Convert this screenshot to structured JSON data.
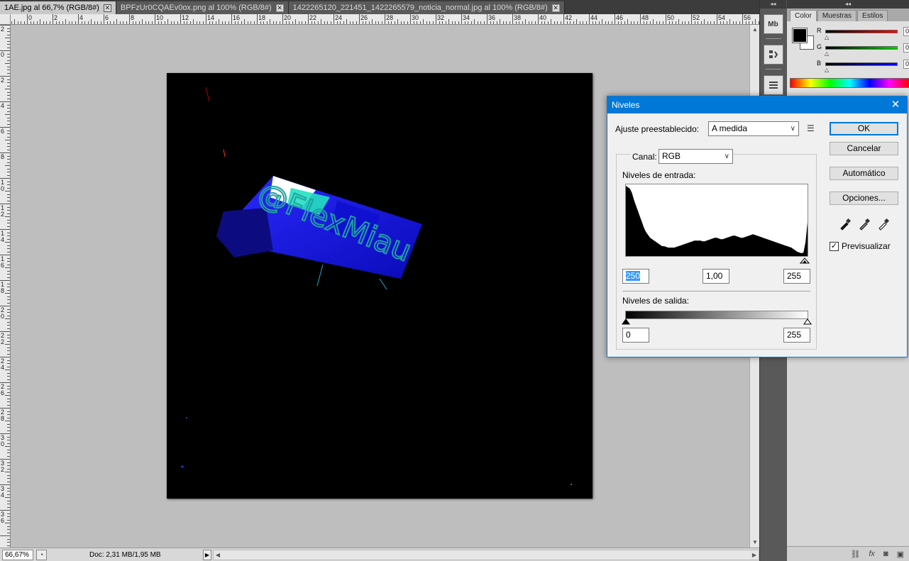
{
  "tabs": [
    {
      "label": "1AE.jpg al 66,7% (RGB/8#)",
      "active": true
    },
    {
      "label": "BPFzUr0CQAEv0ox.png al 100% (RGB/8#)",
      "active": false
    },
    {
      "label": "1422265120_221451_1422265579_noticia_normal.jpg al 100% (RGB/8#)",
      "active": false
    }
  ],
  "tab_close_glyph": "✕",
  "ruler_top_numbers": [
    "2",
    "0",
    "2",
    "4",
    "6",
    "8",
    "10",
    "12",
    "14",
    "16",
    "18",
    "20",
    "22",
    "24",
    "26",
    "28",
    "30",
    "32",
    "34",
    "36",
    "38",
    "40",
    "42",
    "44",
    "46",
    "48",
    "50",
    "52",
    "54",
    "56"
  ],
  "ruler_left_numbers": [
    "2",
    "0",
    "2",
    "4",
    "6",
    "8",
    "10",
    "12",
    "14",
    "16",
    "18",
    "20",
    "22",
    "24",
    "26",
    "28",
    "30",
    "32",
    "34",
    "36"
  ],
  "document_image": {
    "description_icon": "image-canvas",
    "text_overlay": "@FlexMiau"
  },
  "status": {
    "zoom": "66,67%",
    "doc_info": "Doc: 2,31 MB/1,95 MB",
    "arrow": "▶"
  },
  "right_panel": {
    "collapse_glyph": "◂◂",
    "tabs": [
      {
        "label": "Color",
        "active": true
      },
      {
        "label": "Muestras",
        "active": false
      },
      {
        "label": "Estilos",
        "active": false
      }
    ],
    "sliders": [
      {
        "label": "R",
        "value": "0",
        "color": "#ff0000"
      },
      {
        "label": "G",
        "value": "0",
        "color": "#00b000"
      },
      {
        "label": "B",
        "value": "0",
        "color": "#0000ff"
      }
    ],
    "strip_icons": [
      "Mb",
      "history-icon",
      "properties-icon"
    ],
    "bottom_icons": [
      "link-icon",
      "fx-icon",
      "mask-icon",
      "new-layer-icon"
    ]
  },
  "dialog": {
    "title": "Niveles",
    "close_glyph": "✕",
    "preset_label": "Ajuste preestablecido:",
    "preset_value": "A medida",
    "channel_label": "Canal:",
    "channel_value": "RGB",
    "input_levels_label": "Niveles de entrada:",
    "input_black": "250",
    "input_gamma": "1,00",
    "input_white": "255",
    "output_levels_label": "Niveles de salida:",
    "output_black": "0",
    "output_white": "255",
    "buttons": {
      "ok": "OK",
      "cancel": "Cancelar",
      "auto": "Automático",
      "options": "Opciones..."
    },
    "preview_label": "Previsualizar",
    "preview_checked": true,
    "histogram_shape": [
      100,
      98,
      96,
      90,
      80,
      72,
      64,
      56,
      48,
      40,
      34,
      30,
      26,
      24,
      22,
      20,
      18,
      16,
      14,
      14,
      13,
      12,
      12,
      12,
      12,
      13,
      14,
      15,
      16,
      17,
      18,
      19,
      20,
      21,
      22,
      22,
      22,
      22,
      21,
      21,
      22,
      23,
      24,
      25,
      26,
      26,
      25,
      24,
      24,
      25,
      26,
      27,
      28,
      29,
      29,
      28,
      27,
      26,
      26,
      27,
      28,
      29,
      30,
      31,
      30,
      29,
      28,
      27,
      26,
      25,
      24,
      23,
      22,
      21,
      20,
      19,
      18,
      17,
      16,
      15,
      14,
      13,
      12,
      10,
      8,
      6,
      5,
      4,
      5,
      20,
      48
    ]
  }
}
